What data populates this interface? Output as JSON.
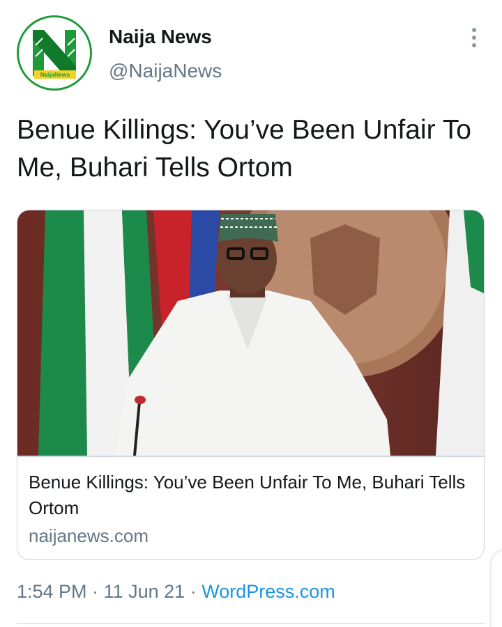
{
  "author": {
    "display_name": "Naija News",
    "handle": "@NaijaNews",
    "avatar_icon": "naija-news-logo",
    "avatar_logo_text": "NaijaNews"
  },
  "tweet": {
    "text": "Benue Killings: You’ve Been Unfair To Me, Buhari Tells Ortom"
  },
  "card": {
    "image_description": "photo",
    "title": "Benue Killings: You’ve Been Unfair To Me, Buhari Tells Ortom",
    "domain": "naijanews.com"
  },
  "meta": {
    "time": "1:54 PM",
    "separator": "·",
    "date": "11 Jun 21",
    "source": "WordPress.com"
  },
  "colors": {
    "brand_green": "#1f9a3a",
    "link_blue": "#1b95e0",
    "muted_gray": "#657786"
  }
}
